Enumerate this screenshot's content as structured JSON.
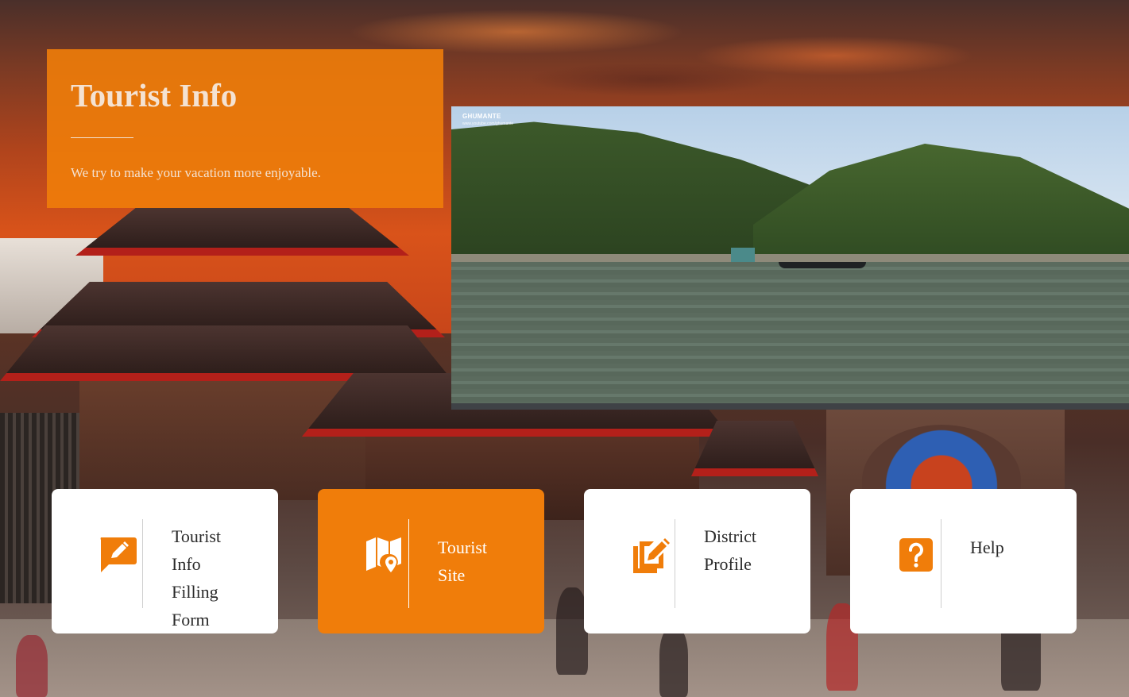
{
  "hero": {
    "title": "Tourist Info",
    "subtitle": "We try to make your vacation more enjoyable."
  },
  "video": {
    "brand": "GHUMANTE",
    "tagline": "",
    "url": "www.youtube.com/ghumante"
  },
  "cards": [
    {
      "id": "tourist-info-filling-form",
      "label_lines": [
        "Tourist",
        "Info",
        "Filling",
        "Form"
      ],
      "icon": "pencil-message-icon",
      "active": false
    },
    {
      "id": "tourist-site",
      "label_lines": [
        "Tourist",
        "Site"
      ],
      "icon": "map-pin-icon",
      "active": true
    },
    {
      "id": "district-profile",
      "label_lines": [
        "District",
        "Profile"
      ],
      "icon": "edit-document-icon",
      "active": false
    },
    {
      "id": "help",
      "label_lines": [
        "Help"
      ],
      "icon": "question-icon",
      "active": false
    }
  ],
  "colors": {
    "accent": "#f07d0a",
    "card_bg": "#ffffff",
    "card_text": "#2a2a2a",
    "hero_text": "#f4e2d2"
  }
}
